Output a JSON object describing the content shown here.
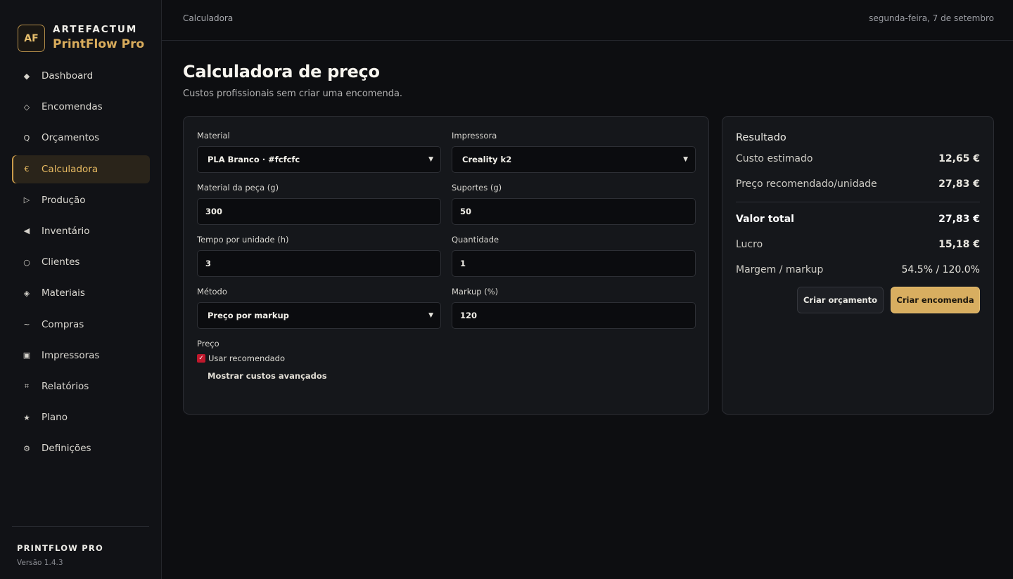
{
  "brand": {
    "logo": "AF",
    "name": "ARTEFACTUM",
    "product": "PrintFlow Pro"
  },
  "nav": [
    {
      "label": "Dashboard",
      "icon": "◆",
      "icon_name": "diamond-filled-icon"
    },
    {
      "label": "Encomendas",
      "icon": "◇",
      "icon_name": "diamond-outline-icon"
    },
    {
      "label": "Orçamentos",
      "icon": "Q",
      "icon_name": "quote-icon"
    },
    {
      "label": "Calculadora",
      "icon": "€",
      "icon_name": "euro-icon",
      "active": true
    },
    {
      "label": "Produção",
      "icon": "▷",
      "icon_name": "play-outline-icon"
    },
    {
      "label": "Inventário",
      "icon": "◀",
      "icon_name": "triangle-left-icon"
    },
    {
      "label": "Clientes",
      "icon": "○",
      "icon_name": "circle-icon"
    },
    {
      "label": "Materiais",
      "icon": "◈",
      "icon_name": "material-diamond-icon"
    },
    {
      "label": "Compras",
      "icon": "~",
      "icon_name": "tilde-icon"
    },
    {
      "label": "Impressoras",
      "icon": "▣",
      "icon_name": "printer-square-icon"
    },
    {
      "label": "Relatórios",
      "icon": "⌗",
      "icon_name": "hash-icon"
    },
    {
      "label": "Plano",
      "icon": "★",
      "icon_name": "star-icon"
    },
    {
      "label": "Definições",
      "icon": "⚙",
      "icon_name": "gear-icon"
    }
  ],
  "footer": {
    "name": "PRINTFLOW PRO",
    "version": "Versão 1.4.3"
  },
  "topbar": {
    "breadcrumb": "Calculadora",
    "date": "segunda-feira, 7 de setembro"
  },
  "page": {
    "title": "Calculadora de preço",
    "subtitle": "Custos profissionais sem criar uma encomenda."
  },
  "form": {
    "material_label": "Material",
    "material_value": "PLA Branco · #fcfcfc",
    "printer_label": "Impressora",
    "printer_value": "Creality k2",
    "part_material_label": "Material da peça (g)",
    "part_material_value": "300",
    "supports_label": "Suportes (g)",
    "supports_value": "50",
    "time_label": "Tempo por unidade (h)",
    "time_value": "3",
    "quantity_label": "Quantidade",
    "quantity_value": "1",
    "method_label": "Método",
    "method_value": "Preço por markup",
    "markup_label": "Markup (%)",
    "markup_value": "120",
    "price_label": "Preço",
    "use_recommended_label": "Usar recomendado",
    "use_recommended_checked": true,
    "advanced_label": "Mostrar custos avançados"
  },
  "result": {
    "title": "Resultado",
    "estimated_cost_label": "Custo estimado",
    "estimated_cost_value": "12,65 €",
    "recommended_label": "Preço recomendado/unidade",
    "recommended_value": "27,83 €",
    "total_label": "Valor total",
    "total_value": "27,83 €",
    "profit_label": "Lucro",
    "profit_value": "15,18 €",
    "margin_label": "Margem / markup",
    "margin_value": "54.5% / 120.0%",
    "quote_button": "Criar orçamento",
    "order_button": "Criar encomenda"
  },
  "colors": {
    "accent": "#d8ae60",
    "background": "#0d0e11",
    "card": "#15171b",
    "checkbox": "#c0182c"
  }
}
